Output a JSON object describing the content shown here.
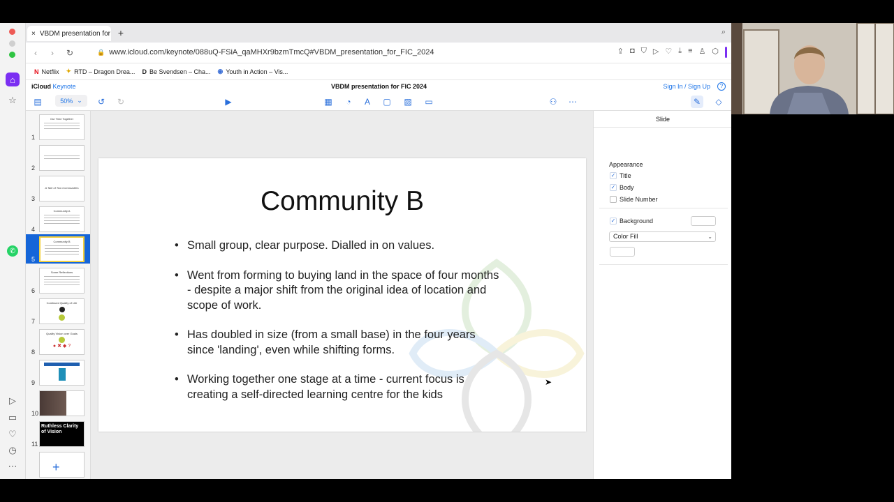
{
  "browser": {
    "tab_title": "VBDM presentation for F",
    "tab_close": "×",
    "new_tab": "+",
    "url": "www.icloud.com/keynote/088uQ-FSiA_qaMHXr9bzmTmcQ#VBDM_presentation_for_FIC_2024",
    "bookmarks": [
      {
        "label": "Netflix",
        "icon": "N"
      },
      {
        "label": "RTD – Dragon Drea...",
        "icon": "✦"
      },
      {
        "label": "Be Svendsen – Cha...",
        "icon": "D"
      },
      {
        "label": "Youth in Action – Vis...",
        "icon": "◉"
      }
    ]
  },
  "keynote": {
    "brand_icloud": "iCloud",
    "brand_app": "Keynote",
    "doc_title": "VBDM presentation for FIC 2024",
    "signin": "Sign In / Sign Up",
    "help": "?",
    "zoom": "50%",
    "add_slide": "+"
  },
  "navigator": {
    "slides": [
      {
        "num": "1",
        "title": "Our Time Together"
      },
      {
        "num": "2",
        "title": ""
      },
      {
        "num": "3",
        "title": "A Tale of Two Communities"
      },
      {
        "num": "4",
        "title": "Community A"
      },
      {
        "num": "5",
        "title": "Community B"
      },
      {
        "num": "6",
        "title": "Some Reflections"
      },
      {
        "num": "7",
        "title": "Continued Quality of Life"
      },
      {
        "num": "8",
        "title": "Quality Vision over Goals"
      },
      {
        "num": "9",
        "title": ""
      },
      {
        "num": "10",
        "title": ""
      },
      {
        "num": "11",
        "title": "Ruthless Clarity of Vision"
      }
    ]
  },
  "slide": {
    "title": "Community B",
    "bullets": [
      "Small group, clear purpose. Dialled in on values.",
      "Went from forming to buying land in the space of four months - despite a major shift from the original idea of location and scope of work.",
      "Has doubled in size (from a small base) in the four years since 'landing', even while shifting forms.",
      "Working together one stage at a time - current focus is creating a self-directed learning centre for the kids"
    ]
  },
  "inspector": {
    "heading": "Slide",
    "appearance_label": "Appearance",
    "title_label": "Title",
    "title_checked": true,
    "body_label": "Body",
    "body_checked": true,
    "slide_number_label": "Slide Number",
    "slide_number_checked": false,
    "background_label": "Background",
    "background_checked": true,
    "fill_type": "Color Fill"
  },
  "colors": {
    "accent": "#1a73e8",
    "selection": "#1565d8",
    "selected_border": "#f4d03f"
  }
}
